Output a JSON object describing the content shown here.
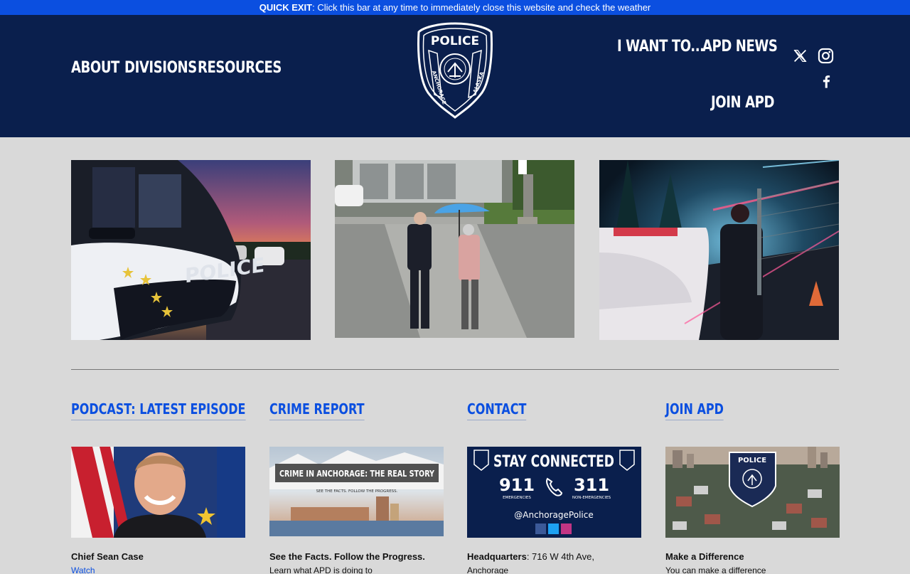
{
  "quick_exit": {
    "label": "QUICK EXIT",
    "text": ": Click this bar at any time to immediately close this website and check the weather"
  },
  "nav": {
    "about": "ABOUT",
    "divisions": "DIVISIONS",
    "resources": "RESOURCES",
    "i_want_to": "I WANT TO...",
    "apd_news": "APD NEWS",
    "join_apd": "JOIN APD"
  },
  "logo": {
    "top_text": "POLICE",
    "left_text": "ANCHORAGE",
    "right_text": "ALASKA"
  },
  "social": [
    "x-icon",
    "instagram-icon",
    "facebook-icon"
  ],
  "columns": [
    {
      "title": "PODCAST: LATEST EPISODE",
      "caption": "Chief Sean Case",
      "sub": "Watch"
    },
    {
      "title": "CRIME REPORT",
      "caption": "See the Facts. Follow the Progress.",
      "sub": "Learn what APD is doing to"
    },
    {
      "title": "CONTACT",
      "caption": "Headquarters",
      "caption_rest": ": 716 W 4th Ave,",
      "sub": "Anchorage"
    },
    {
      "title": "JOIN APD",
      "caption": "Make a Difference",
      "sub": "You can make a difference"
    }
  ],
  "crime_banner": {
    "title": "CRIME IN ANCHORAGE: THE REAL STORY",
    "tagline": "SEE THE FACTS. FOLLOW THE PROGRESS."
  },
  "stay_connected": {
    "title": "STAY CONNECTED",
    "n911": "911",
    "n911_label": "EMERGENCIES",
    "n311": "311",
    "n311_label": "NON-EMERGENCIES",
    "handle": "@AnchoragePolice"
  },
  "join_badge": {
    "text": "POLICE"
  },
  "car_text": "POLICE",
  "colors": {
    "header_bg": "#0a1f4d",
    "quick_exit_bg": "#0b4fe0",
    "accent": "#0b4fe0",
    "page_bg": "#d9d9d9"
  }
}
